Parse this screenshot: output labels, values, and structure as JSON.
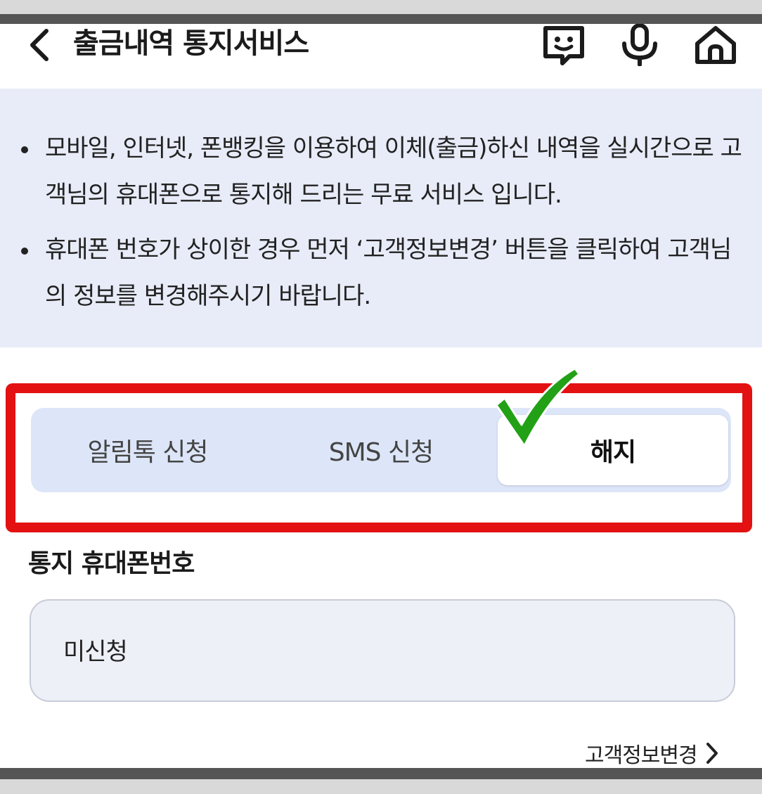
{
  "header": {
    "title": "출금내역 통지서비스",
    "icons": [
      "back-icon",
      "chatbot-icon",
      "mic-icon",
      "home-icon"
    ]
  },
  "info": {
    "bullets": [
      "모바일, 인터넷, 폰뱅킹을 이용하여 이체(출금)하신 내역을 실시간으로 고객님의 휴대폰으로 통지해 드리는 무료 서비스 입니다.",
      "휴대폰 번호가 상이한 경우 먼저 ‘고객정보변경’ 버튼을 클릭하여 고객님의 정보를 변경해주시기 바랍니다."
    ]
  },
  "tabs": {
    "items": [
      {
        "label": "알림톡 신청",
        "selected": false
      },
      {
        "label": "SMS 신청",
        "selected": false
      },
      {
        "label": "해지",
        "selected": true
      }
    ],
    "highlight_color": "#e31111",
    "check_color": "#22a016"
  },
  "phone": {
    "label": "통지 휴대폰번호",
    "value": "미신청"
  },
  "links": {
    "change_info": "고객정보변경"
  }
}
